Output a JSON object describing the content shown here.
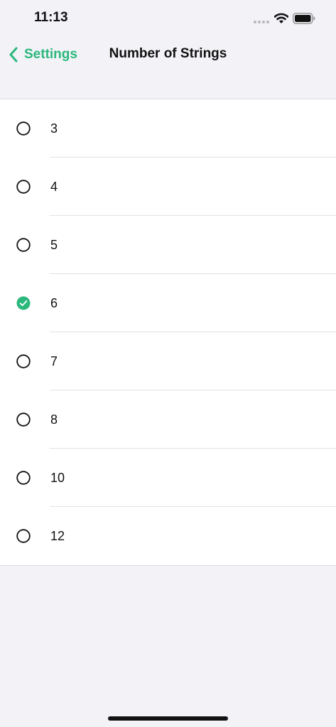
{
  "status_bar": {
    "time": "11:13",
    "icons": [
      "signal-dots-icon",
      "wifi-icon",
      "battery-icon"
    ]
  },
  "nav": {
    "back_label": "Settings",
    "title": "Number of Strings",
    "back_icon": "chevron-left-icon"
  },
  "colors": {
    "accent": "#2bb87c",
    "background": "#f2f2f7",
    "list_background": "#ffffff"
  },
  "options": [
    {
      "label": "3",
      "selected": false
    },
    {
      "label": "4",
      "selected": false
    },
    {
      "label": "5",
      "selected": false
    },
    {
      "label": "6",
      "selected": true
    },
    {
      "label": "7",
      "selected": false
    },
    {
      "label": "8",
      "selected": false
    },
    {
      "label": "10",
      "selected": false
    },
    {
      "label": "12",
      "selected": false
    }
  ]
}
